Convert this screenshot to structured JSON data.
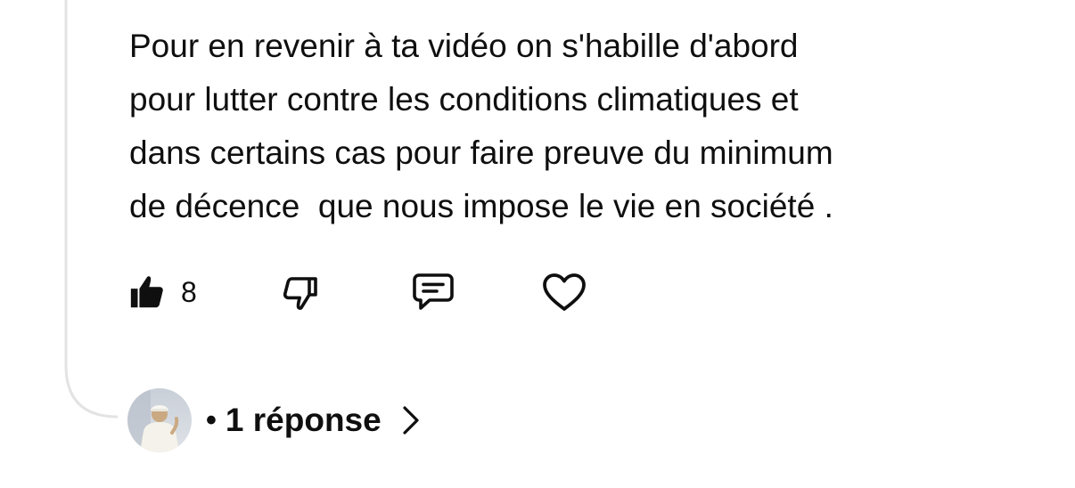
{
  "comment": {
    "text": "Pour en revenir à ta vidéo on s'habille d'abord\npour lutter contre les conditions climatiques et\ndans certains cas pour faire preuve du minimum\nde décence  que nous impose le vie en société ."
  },
  "actions": {
    "like_count": "8",
    "like_icon": "thumbs-up-filled",
    "dislike_icon": "thumbs-down-outline",
    "reply_icon": "comment-bubble",
    "heart_icon": "heart-outline"
  },
  "replies": {
    "separator": "•",
    "label": "1 réponse",
    "chevron_icon": "chevron-right"
  }
}
